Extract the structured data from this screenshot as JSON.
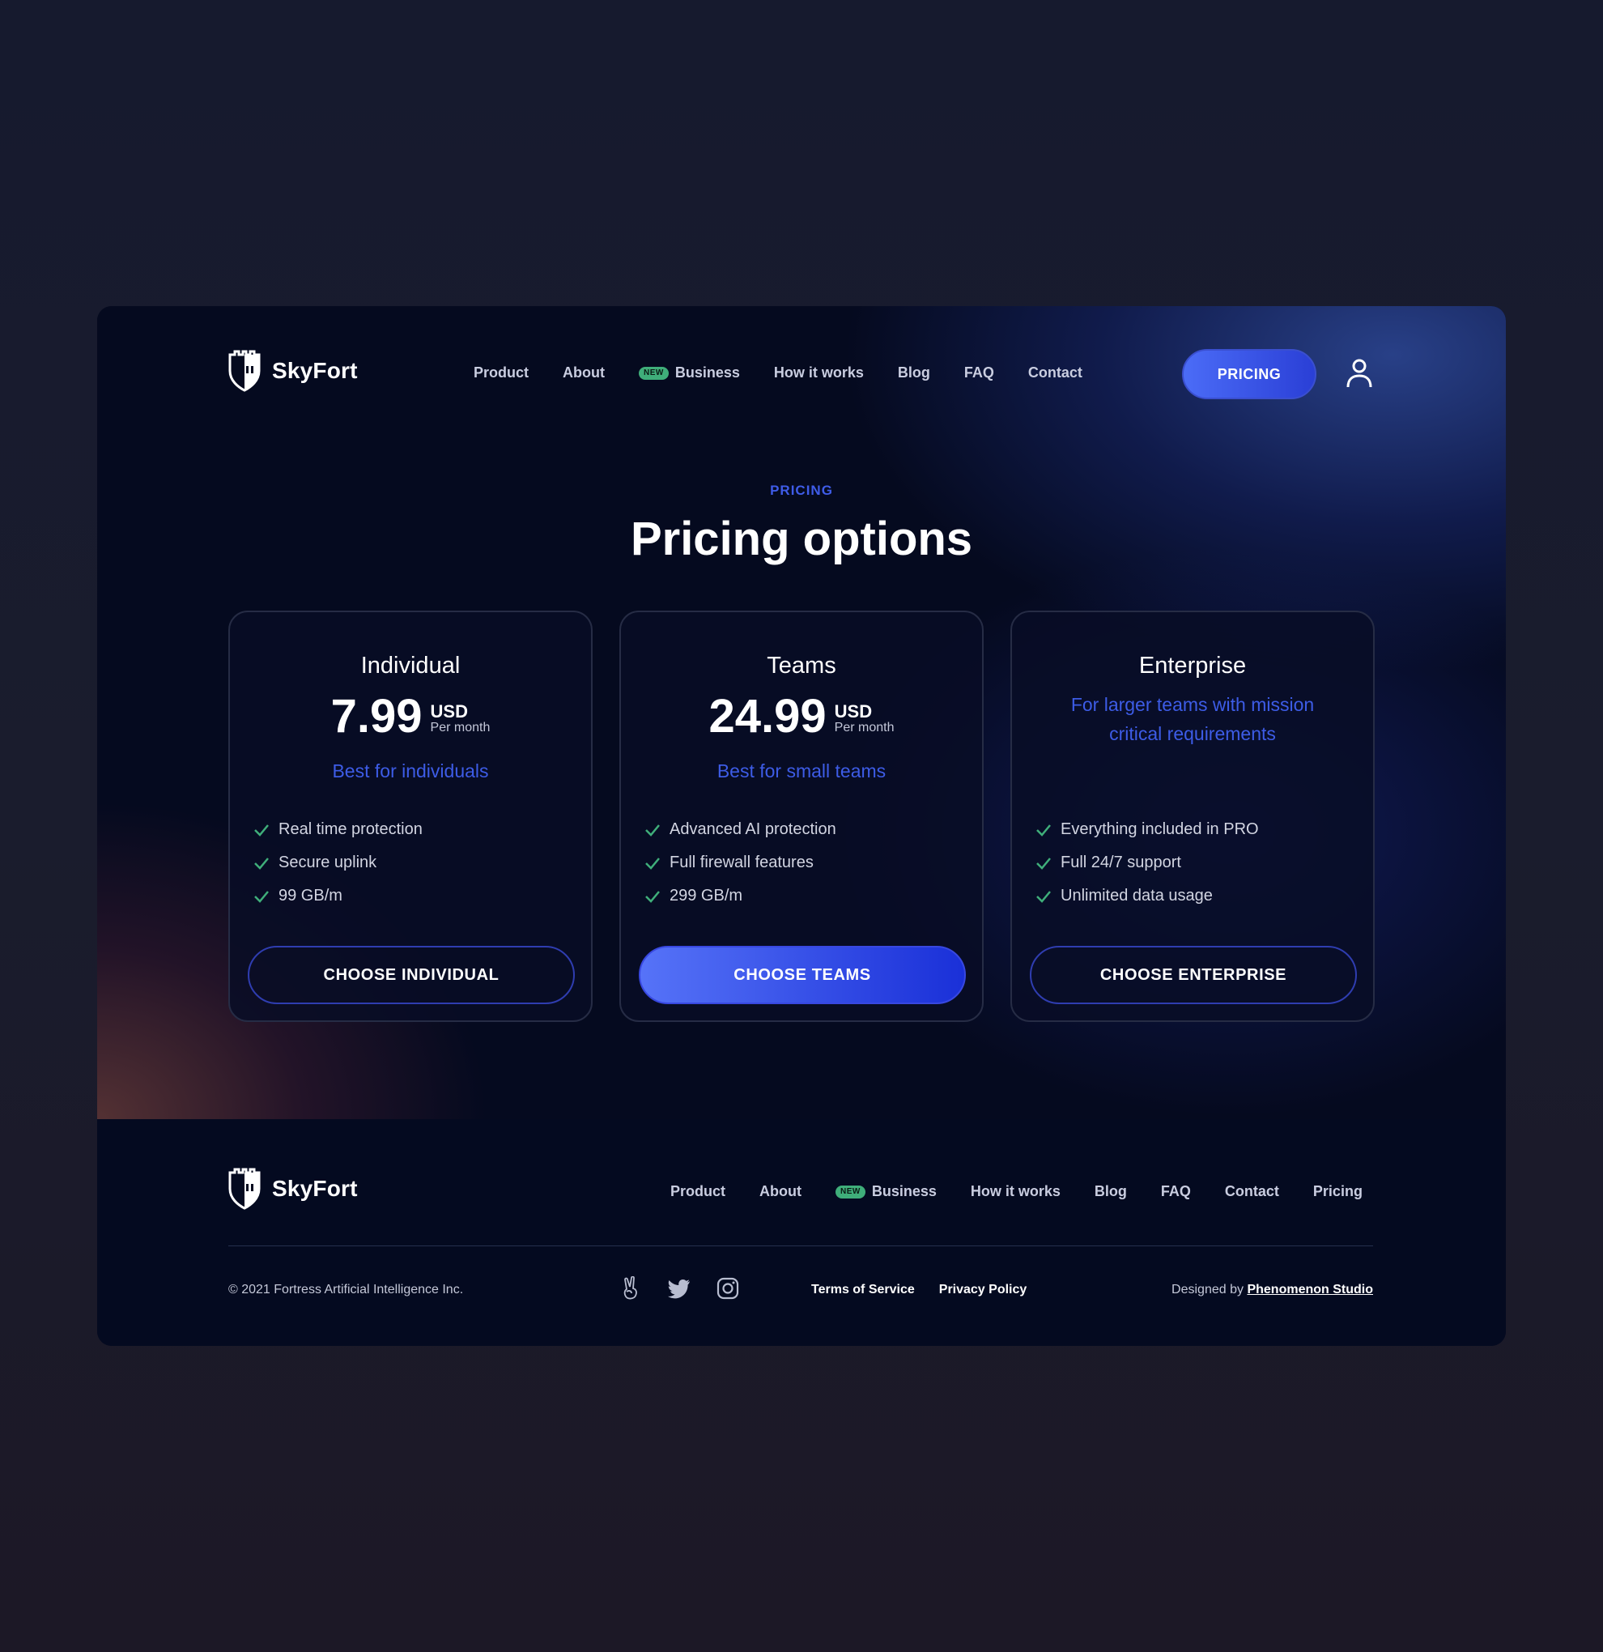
{
  "brand": {
    "name": "SkyFort"
  },
  "header": {
    "nav": [
      {
        "label": "Product"
      },
      {
        "label": "About"
      },
      {
        "label": "Business",
        "badge": "NEW"
      },
      {
        "label": "How it works"
      },
      {
        "label": "Blog"
      },
      {
        "label": "FAQ"
      },
      {
        "label": "Contact"
      }
    ],
    "cta_label": "PRICING",
    "user_icon": "user-icon"
  },
  "hero": {
    "eyebrow": "PRICING",
    "title": "Pricing options"
  },
  "plans": [
    {
      "name": "Individual",
      "price": "7.99",
      "currency": "USD",
      "period": "Per month",
      "tagline": "Best for individuals",
      "features": [
        "Real time protection",
        "Secure uplink",
        "99 GB/m"
      ],
      "button": "CHOOSE INDIVIDUAL"
    },
    {
      "name": "Teams",
      "price": "24.99",
      "currency": "USD",
      "period": "Per month",
      "tagline": "Best for small teams",
      "features": [
        "Advanced AI protection",
        "Full firewall features",
        "299 GB/m"
      ],
      "button": "CHOOSE TEAMS",
      "highlighted": true
    },
    {
      "name": "Enterprise",
      "tagline": "For larger teams with mission critical requirements",
      "features": [
        "Everything included in PRO",
        "Full 24/7 support",
        "Unlimited data usage"
      ],
      "button": "CHOOSE ENTERPRISE"
    }
  ],
  "footer": {
    "nav": [
      {
        "label": "Product"
      },
      {
        "label": "About"
      },
      {
        "label": "Business",
        "badge": "NEW"
      },
      {
        "label": "How it works"
      },
      {
        "label": "Blog"
      },
      {
        "label": "FAQ"
      },
      {
        "label": "Contact"
      },
      {
        "label": "Pricing"
      }
    ],
    "copyright": "© 2021 Fortress Artificial Intelligence Inc.",
    "socials": [
      "peace-icon",
      "twitter-icon",
      "instagram-icon"
    ],
    "terms": "Terms of Service",
    "privacy": "Privacy Policy",
    "designed_by_prefix": "Designed by",
    "designed_by_studio": "Phenomenon Studio"
  },
  "colors": {
    "accent": "#3f5ce8",
    "badge": "#3fae7a",
    "check": "#3fae7a",
    "background": "#050a1f"
  }
}
